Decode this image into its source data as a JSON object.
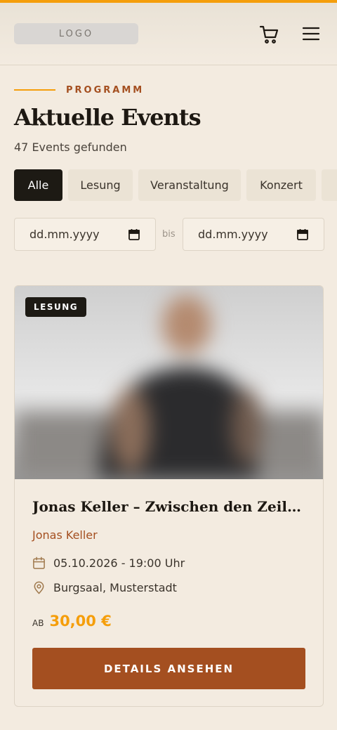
{
  "header": {
    "logo_text": "LOGO",
    "cart_icon": "cart-icon",
    "menu_icon": "hamburger-menu-icon"
  },
  "colors": {
    "accent": "#f59e0b",
    "brand": "#a44f20",
    "chip_active": "#1d1a14",
    "background": "#f3ebe0"
  },
  "section": {
    "eyebrow": "PROGRAMM",
    "title": "Aktuelle Events",
    "result_count": "47 Events gefunden"
  },
  "filters": {
    "categories": [
      "Alle",
      "Lesung",
      "Veranstaltung",
      "Konzert"
    ],
    "active_category": "Alle",
    "date_from_placeholder": "dd.mm.yyyy",
    "date_separator": "bis",
    "date_to_placeholder": "dd.mm.yyyy",
    "date_icon": "calendar-icon"
  },
  "events": [
    {
      "badge": "LESUNG",
      "title": "Jonas Keller – Zwischen den Zeilen …",
      "artist": "Jonas Keller",
      "datetime": "05.10.2026 - 19:00 Uhr",
      "datetime_icon": "calendar-icon",
      "venue": "Burgsaal, Musterstadt",
      "venue_icon": "location-pin-icon",
      "price_prefix": "AB",
      "price": "30,00 €",
      "button_label": "DETAILS ANSEHEN"
    }
  ]
}
